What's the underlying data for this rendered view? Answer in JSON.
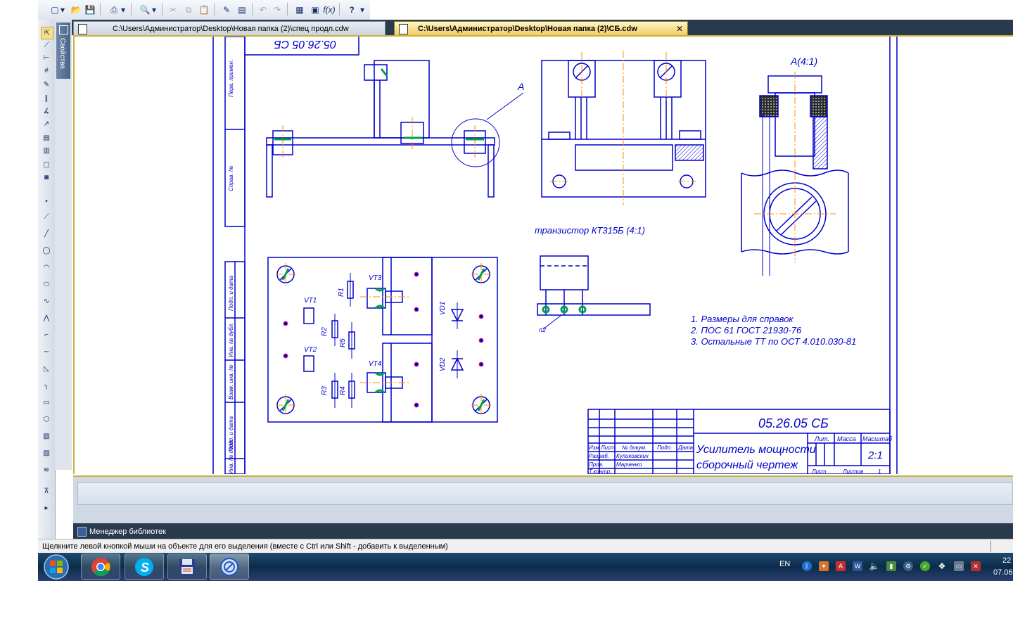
{
  "toolbar": {
    "buttons": [
      "new-document",
      "open",
      "save",
      "print",
      "preview",
      "cut",
      "copy",
      "paste",
      "format-painter",
      "properties",
      "undo",
      "redo",
      "manager",
      "variables",
      "function",
      "help"
    ],
    "function_label": "f(x)"
  },
  "tabs": [
    {
      "label": "C:\\Users\\Администратор\\Desktop\\Новая папка (2)\\спец продл.cdw",
      "active": false
    },
    {
      "label": "C:\\Users\\Администратор\\Desktop\\Новая папка (2)\\СБ.cdw",
      "active": true,
      "close": "✕"
    }
  ],
  "properties_panel": {
    "label": "Свойства"
  },
  "drawing": {
    "top_code": "05.26.05 СБ",
    "view_label_a": "А",
    "view_label_detail": "А(4:1)",
    "transistor_caption": "транзистор  КТ315Б (4:1)",
    "callout": "п2",
    "notes": [
      "1. Размеры для справок",
      "2. ПОС 61 ГОСТ 21930-76",
      "3. Остальные ТТ по ОСТ 4.010.030-81"
    ],
    "components": [
      "VT1",
      "VT2",
      "VT3",
      "VT4",
      "R1",
      "R2",
      "R3",
      "R4",
      "R5",
      "VD1",
      "VD2"
    ],
    "side_stamps": [
      "Перв. примен.",
      "Справ. №",
      "Подп. и дата",
      "Инв. № дубл.",
      "Взам. инв. №",
      "Подп. и дата",
      "Инв. № подл."
    ],
    "title_block": {
      "code": "05.26.05 СБ",
      "name_line1": "Усилитель мощности",
      "name_line2": "сборочный чертеж",
      "col_lit": "Лит.",
      "col_mass": "Масса",
      "col_scale": "Масштаб",
      "scale": "2:1",
      "headers": [
        "Изм.",
        "Лист",
        "№ докум.",
        "Подп.",
        "Дата"
      ],
      "row_developer": "Разраб.",
      "developer": "Куликовских",
      "row_checked": "Пров.",
      "checker": "Марченко",
      "row_tcontr": "Т.контр.",
      "sheet_label": "Лист",
      "sheets_label": "Листов",
      "sheets": "1"
    }
  },
  "library_manager": {
    "label": "Менеджер библиотек"
  },
  "status": {
    "text": "Щелкните левой кнопкой мыши на объекте для его выделения (вместе с Ctrl или Shift - добавить к выделенным)"
  },
  "taskbar": {
    "apps": [
      "chrome",
      "skype",
      "save-disk",
      "kompas"
    ],
    "lang": "EN",
    "time": "22",
    "date": "07.06"
  },
  "colors": {
    "drawing_blue": "#0000cc",
    "axis_orange": "#ff8c00",
    "solder_green": "#00a050",
    "accent_yellow": "#c9b23c"
  }
}
